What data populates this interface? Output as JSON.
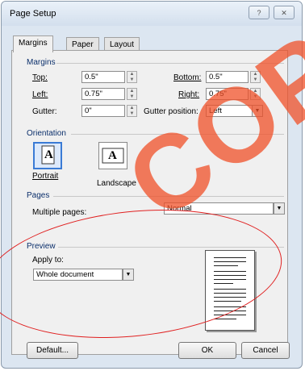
{
  "window": {
    "title": "Page Setup",
    "help_glyph": "?",
    "close_glyph": "✕"
  },
  "tabs": [
    {
      "label": "Margins",
      "active": true
    },
    {
      "label": "Paper",
      "active": false
    },
    {
      "label": "Layout",
      "active": false
    }
  ],
  "margins": {
    "section": "Margins",
    "top_label": "Top:",
    "top_value": "0.5\"",
    "bottom_label": "Bottom:",
    "bottom_value": "0.5\"",
    "left_label": "Left:",
    "left_value": "0.75\"",
    "right_label": "Right:",
    "right_value": "0.75\"",
    "gutter_label": "Gutter:",
    "gutter_value": "0\"",
    "gutter_position_label": "Gutter position:",
    "gutter_position_value": "Left"
  },
  "orientation": {
    "section": "Orientation",
    "portrait_label": "Portrait",
    "landscape_label": "Landscape",
    "icon_letter": "A",
    "selected": "Portrait"
  },
  "pages": {
    "section": "Pages",
    "multiple_label": "Multiple pages:",
    "multiple_value": "Normal"
  },
  "preview": {
    "section": "Preview",
    "apply_label": "Apply to:",
    "apply_value": "Whole document"
  },
  "buttons": {
    "default": "Default...",
    "ok": "OK",
    "cancel": "Cancel"
  },
  "overlay": {
    "watermark": "COP",
    "watermark_color": "#f05028",
    "ellipse_color": "#e02020"
  }
}
